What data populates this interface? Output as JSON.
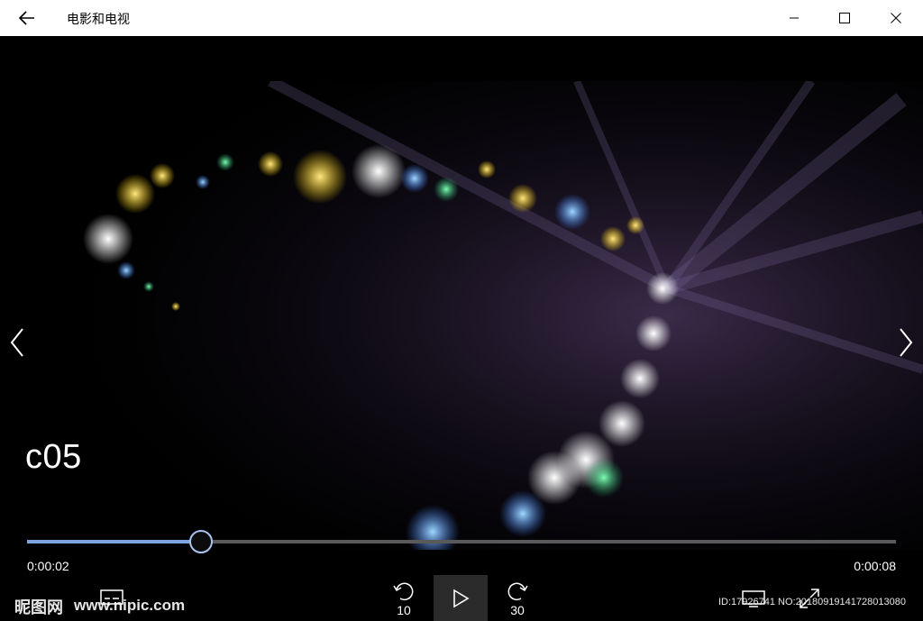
{
  "window": {
    "title": "电影和电视",
    "back_icon": "arrow-left-icon",
    "minimize_icon": "minimize-icon",
    "maximize_icon": "maximize-icon",
    "close_icon": "close-icon"
  },
  "player": {
    "video_title": "c05",
    "elapsed_time": "0:00:02",
    "total_time": "0:00:08",
    "progress": 0.2,
    "prev_icon": "chevron-left-icon",
    "next_icon": "chevron-right-icon",
    "controls": {
      "skip_back_label": "10",
      "skip_forward_label": "30",
      "play_icon": "play-icon",
      "skip_back_icon": "skip-back-icon",
      "skip_forward_icon": "skip-forward-icon",
      "captions_icon": "captions-icon",
      "cast_icon": "cast-icon",
      "fullscreen_icon": "fullscreen-icon"
    }
  },
  "watermark": {
    "logo": "昵图网",
    "url": "www.nipic.com",
    "id_text": "ID:17926741 NO:20180919141728013080"
  },
  "colors": {
    "titlebar_bg": "#ffffff",
    "background": "#000000",
    "accent": "#7ea3e0",
    "track": "#5a5a5a"
  }
}
